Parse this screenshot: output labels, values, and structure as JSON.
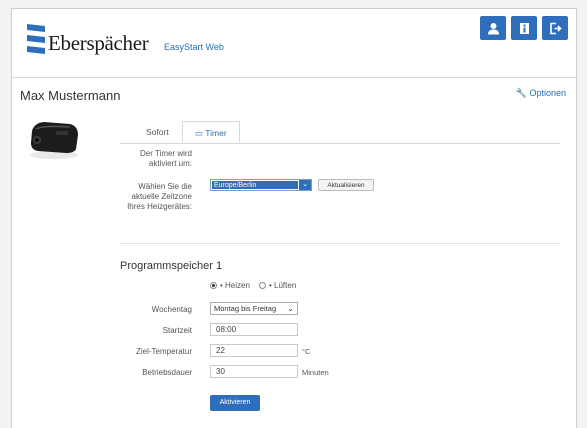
{
  "header": {
    "brand": "Eberspächer",
    "product": "EasyStart Web",
    "icons": [
      "user-icon",
      "info-icon",
      "logout-icon"
    ]
  },
  "user": {
    "name": "Max Mustermann"
  },
  "options_label": "Optionen",
  "tabs": [
    {
      "label": "Sofort"
    },
    {
      "label": "Timer",
      "active": true
    }
  ],
  "timer": {
    "activated_label": "Der Timer wird\naktiviert um:",
    "timezone_label": "Wählen Sie die\naktuelle Zeitzone\nIhres Heizgerätes:",
    "timezone_value": "Europe/Berlin",
    "update_button": "Aktualisieren"
  },
  "program": {
    "title": "Programmspeicher 1",
    "mode_options": [
      "Heizen",
      "Lüften"
    ],
    "mode_selected": "Heizen",
    "weekday_label": "Wochentag",
    "weekday_value": "Montag bis Freitag",
    "start_label": "Startzeit",
    "start_value": "08:00",
    "temp_label": "Ziel-Temperatur",
    "temp_value": "22",
    "temp_unit": "°C",
    "duration_label": "Betriebsdauer",
    "duration_value": "30",
    "duration_unit": "Minuten",
    "activate_button": "Aktivieren"
  },
  "colors": {
    "accent": "#2f6ebb",
    "link": "#2a6fb5"
  }
}
